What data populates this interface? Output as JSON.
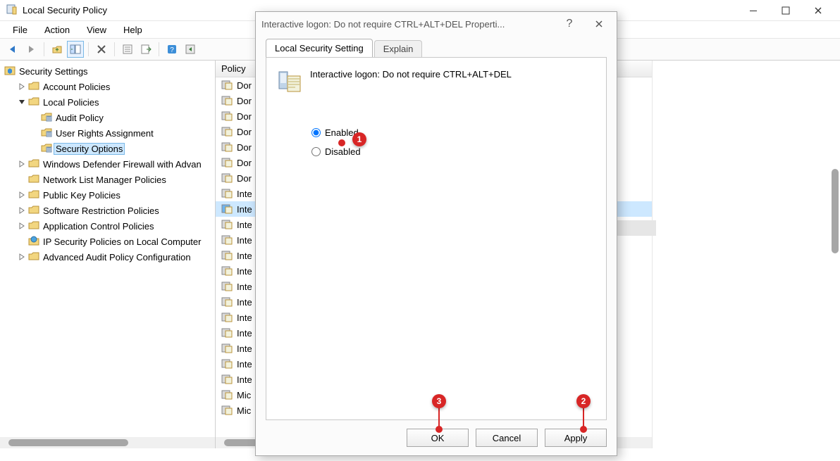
{
  "window": {
    "title": "Local Security Policy",
    "menus": [
      "File",
      "Action",
      "View",
      "Help"
    ]
  },
  "tree": {
    "root": "Security Settings",
    "items": [
      {
        "label": "Account Policies",
        "depth": 1,
        "expander": ">"
      },
      {
        "label": "Local Policies",
        "depth": 1,
        "expander": "v"
      },
      {
        "label": "Audit Policy",
        "depth": 2,
        "expander": ""
      },
      {
        "label": "User Rights Assignment",
        "depth": 2,
        "expander": ""
      },
      {
        "label": "Security Options",
        "depth": 2,
        "expander": "",
        "selected": true
      },
      {
        "label": "Windows Defender Firewall with Advan",
        "depth": 1,
        "expander": ">"
      },
      {
        "label": "Network List Manager Policies",
        "depth": 1,
        "expander": ""
      },
      {
        "label": "Public Key Policies",
        "depth": 1,
        "expander": ">"
      },
      {
        "label": "Software Restriction Policies",
        "depth": 1,
        "expander": ">"
      },
      {
        "label": "Application Control Policies",
        "depth": 1,
        "expander": ">"
      },
      {
        "label": "IP Security Policies on Local Computer",
        "depth": 1,
        "expander": "",
        "ip": true
      },
      {
        "label": "Advanced Audit Policy Configuration",
        "depth": 1,
        "expander": ">"
      }
    ]
  },
  "list": {
    "header_policy": "Policy",
    "rows": [
      "Dor",
      "Dor",
      "Dor",
      "Dor",
      "Dor",
      "Dor",
      "Dor",
      "Inte",
      "Inte",
      "Inte",
      "Inte",
      "Inte",
      "Inte",
      "Inte",
      "Inte",
      "Inte",
      "Inte",
      "Inte",
      "Inte",
      "Inte",
      "Mic",
      "Mic"
    ],
    "selected_index": 8
  },
  "dialog": {
    "title": "Interactive logon: Do not require CTRL+ALT+DEL Properti...",
    "policy_name": "Interactive logon: Do not require CTRL+ALT+DEL",
    "tab_active": "Local Security Setting",
    "tab_explain": "Explain",
    "radio_enabled": "Enabled",
    "radio_disabled": "Disabled",
    "selected_option": "enabled",
    "btn_ok": "OK",
    "btn_cancel": "Cancel",
    "btn_apply": "Apply"
  },
  "markers": {
    "m1": "1",
    "m2": "2",
    "m3": "3"
  }
}
